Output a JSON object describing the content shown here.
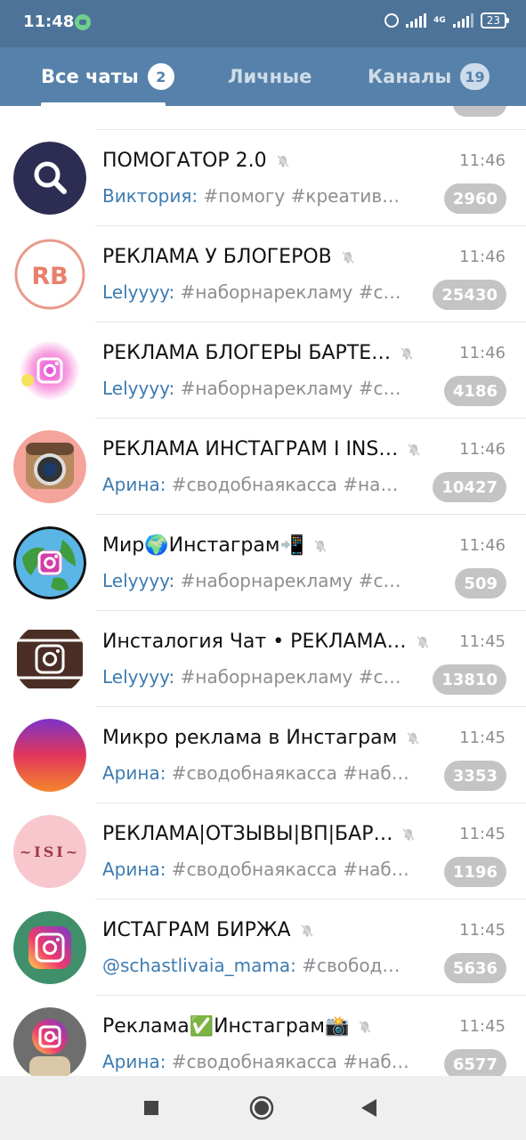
{
  "status": {
    "time": "11:48",
    "network": "4G",
    "battery": "23"
  },
  "tabs": [
    {
      "label": "Все чаты",
      "badge": "2",
      "active": true
    },
    {
      "label": "Личные",
      "badge": ""
    },
    {
      "label": "Каналы",
      "badge": "19"
    }
  ],
  "chats": [
    {
      "title": "ПОМОГАТОР 2.0",
      "time": "11:46",
      "sender": "Виктория:",
      "preview": " #помогу #креатив…",
      "unread": "2960",
      "avatar": "search"
    },
    {
      "title": "РЕКЛАМА У БЛОГЕРОВ",
      "time": "11:46",
      "sender": "Lelyyyy:",
      "preview": " #наборнарекламу #с…",
      "unread": "25430",
      "avatar": "rb"
    },
    {
      "title": "РЕКЛАМА БЛОГЕРЫ БАРТЕ…",
      "time": "11:46",
      "sender": "Lelyyyy:",
      "preview": " #наборнарекламу #св…",
      "unread": "4186",
      "avatar": "ig-splash"
    },
    {
      "title": "РЕКЛАМА ИНСТАГРАМ I INS…",
      "time": "11:46",
      "sender": "Арина:",
      "preview": " #сводобнаякасса #на…",
      "unread": "10427",
      "avatar": "ig-camera"
    },
    {
      "title": "Мир🌍Инстаграм📲",
      "time": "11:46",
      "sender": "Lelyyyy:",
      "preview": " #наборнарекламу #св…",
      "unread": "509",
      "avatar": "ig-globe"
    },
    {
      "title": "Инсталогия Чат • РЕКЛАМА…",
      "time": "11:45",
      "sender": "Lelyyyy:",
      "preview": " #наборнарекламу #с…",
      "unread": "13810",
      "avatar": "ig-dark"
    },
    {
      "title": "Микро реклама в Инстаграм",
      "time": "11:45",
      "sender": "Арина:",
      "preview": " #сводобнаякасса #наб…",
      "unread": "3353",
      "avatar": "gradient"
    },
    {
      "title": "РЕКЛАМА|ОТЗЫВЫ|ВП|БАР…",
      "time": "11:45",
      "sender": "Арина:",
      "preview": " #сводобнаякасса #наб…",
      "unread": "1196",
      "avatar": "isi"
    },
    {
      "title": "ИСТАГРАМ БИРЖА",
      "time": "11:45",
      "sender": "@schastlivaia_mama:",
      "preview": " #свобод…",
      "unread": "5636",
      "avatar": "ig-green"
    },
    {
      "title": "Реклама✅Инстаграм📸",
      "time": "11:45",
      "sender": "Арина:",
      "preview": " #сводобнаякасса #наб…",
      "unread": "6577",
      "avatar": "ig-person"
    }
  ],
  "icons": {
    "mute": "muted-bell-icon",
    "nav": [
      "recent-apps-icon",
      "home-icon",
      "back-icon"
    ]
  },
  "colors": {
    "header": "#5681aa",
    "statusbar": "#4d7398",
    "sender": "#3d7bb0",
    "badge": "#c4c4c4"
  }
}
